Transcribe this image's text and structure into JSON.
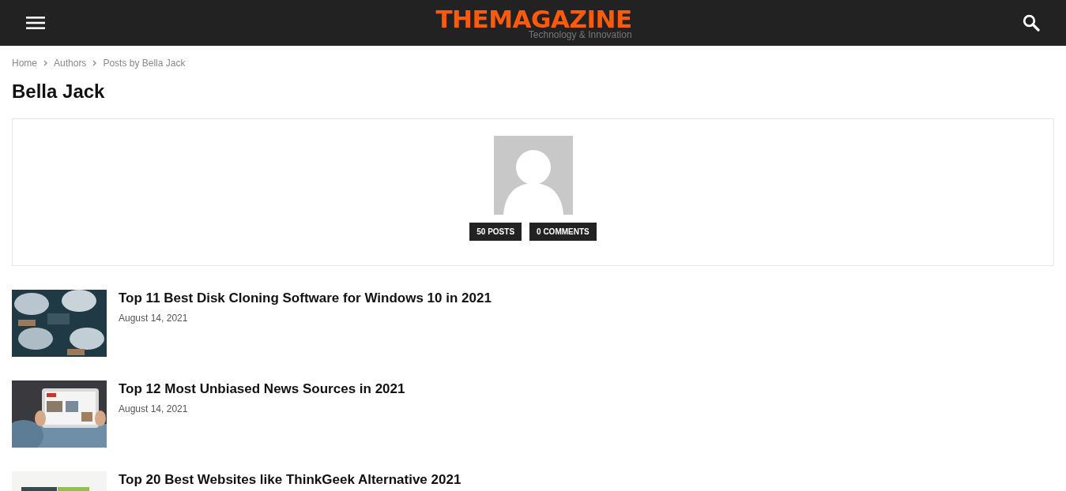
{
  "header": {
    "logo": "THEMAGAZINE",
    "tagline": "Technology & Innovation"
  },
  "breadcrumbs": [
    "Home",
    "Authors",
    "Posts by Bella Jack"
  ],
  "page_title": "Bella Jack",
  "author_box": {
    "badges": [
      "50 POSTS",
      "0 COMMENTS"
    ]
  },
  "posts": [
    {
      "title": "Top 11 Best Disk Cloning Software for Windows 10 in 2021",
      "date": "August 14, 2021"
    },
    {
      "title": "Top 12 Most Unbiased News Sources in 2021",
      "date": "August 14, 2021"
    },
    {
      "title": "Top 20 Best Websites like ThinkGeek Alternative 2021"
    }
  ]
}
